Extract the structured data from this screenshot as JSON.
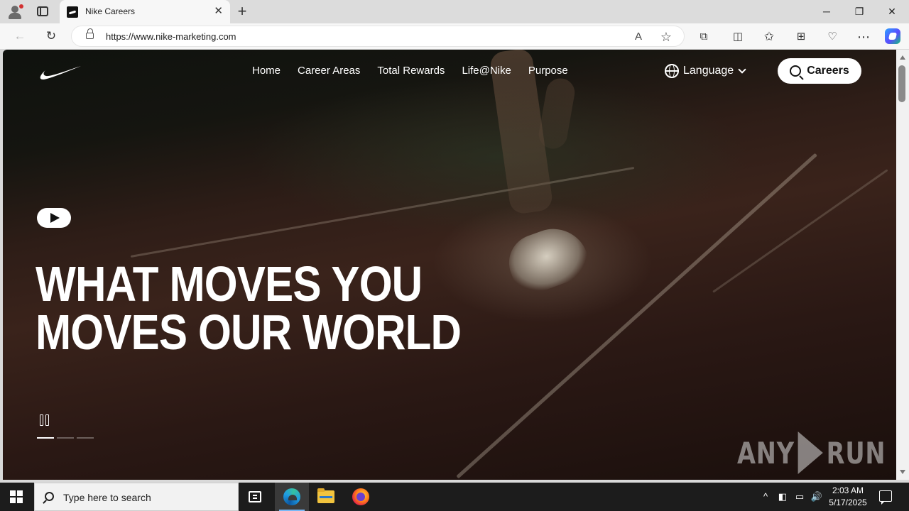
{
  "browser": {
    "tab_title": "Nike Careers",
    "tab_close": "✕",
    "new_tab": "+",
    "url": "https://www.nike-marketing.com",
    "window_controls": {
      "minimize": "─",
      "restore": "❐",
      "close": "✕"
    },
    "nav": {
      "back": "←",
      "reload": "↻"
    },
    "omni_icons": {
      "read_aloud": "A",
      "favorite": "☆"
    },
    "toolbar_icons": {
      "extensions": "⧉",
      "split": "◫",
      "favorites": "✩",
      "collections": "⊞",
      "performance": "♡",
      "more": "⋯"
    }
  },
  "site": {
    "nav": [
      "Home",
      "Career Areas",
      "Total Rewards",
      "Life@Nike",
      "Purpose"
    ],
    "language_label": "Language",
    "careers_button": "Careers",
    "hero_line1": "WHAT MOVES YOU",
    "hero_line2": "MOVES OUR WORLD",
    "carousel": {
      "count": 3,
      "active_index": 0
    }
  },
  "watermark": {
    "left": "ANY",
    "right": "RUN"
  },
  "taskbar": {
    "search_placeholder": "Type here to search",
    "tray": {
      "chevron": "^",
      "meet": "◧",
      "network": "▭",
      "volume": "🔊"
    },
    "time": "2:03 AM",
    "date": "5/17/2025"
  }
}
